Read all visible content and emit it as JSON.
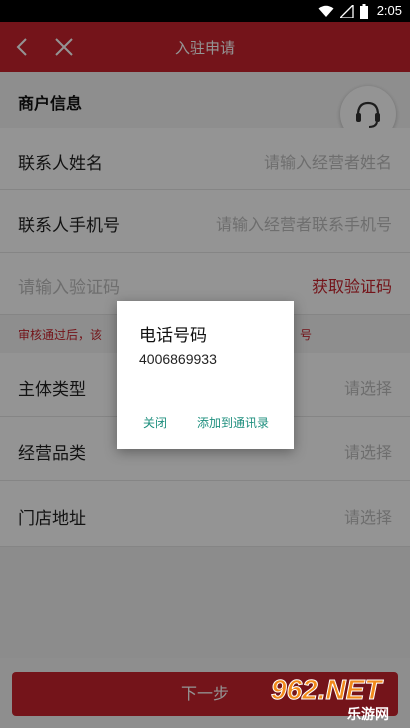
{
  "status_bar": {
    "time": "2:05"
  },
  "title_bar": {
    "title": "入驻申请",
    "back_icon": "chevron-left-icon",
    "close_icon": "close-icon"
  },
  "section": {
    "label": "商户信息",
    "support_icon": "headset-icon"
  },
  "form": {
    "contact_name": {
      "label": "联系人姓名",
      "placeholder": "请输入经营者姓名"
    },
    "contact_phone": {
      "label": "联系人手机号",
      "placeholder": "请输入经营者联系手机号"
    },
    "verification": {
      "placeholder": "请输入验证码",
      "button": "获取验证码"
    },
    "notice": "审核通过后，该",
    "notice_tail": "号",
    "entity_type": {
      "label": "主体类型",
      "value": "请选择"
    },
    "category": {
      "label": "经营品类",
      "value": "请选择"
    },
    "store_address": {
      "label": "门店地址",
      "value": "请选择"
    }
  },
  "next_button": "下一步",
  "dialog": {
    "title": "电话号码",
    "phone": "4006869933",
    "close_label": "关闭",
    "add_label": "添加到通讯录"
  },
  "watermark": {
    "number": "962.NET",
    "text": "乐游网"
  },
  "colors": {
    "accent": "#c8242d",
    "dialog_action": "#1e8f7e"
  }
}
